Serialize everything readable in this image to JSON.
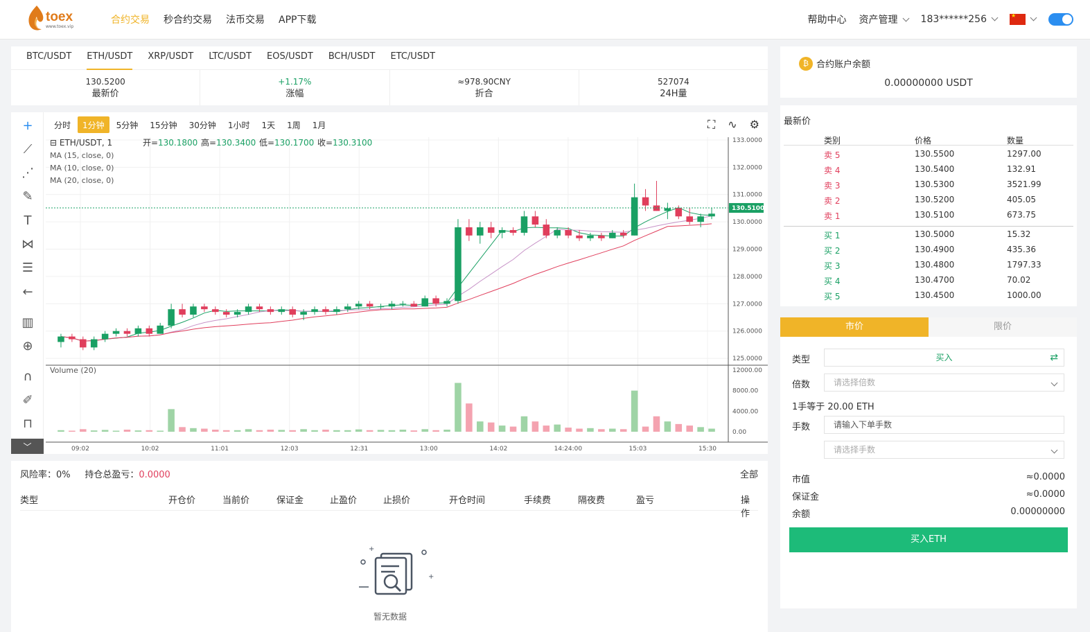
{
  "brand": {
    "name": "toex",
    "site": "www.toex.vip"
  },
  "nav": {
    "links": [
      "合约交易",
      "秒合约交易",
      "法币交易",
      "APP下载"
    ],
    "active": 0,
    "help": "帮助中心",
    "assets": "资产管理",
    "user": "183******256"
  },
  "pairs": [
    "BTC/USDT",
    "ETH/USDT",
    "XRP/USDT",
    "LTC/USDT",
    "EOS/USDT",
    "BCH/USDT",
    "ETC/USDT"
  ],
  "active_pair": 1,
  "stats": [
    {
      "value": "130.5200",
      "label": "最新价"
    },
    {
      "value": "+1.17%",
      "label": "涨幅"
    },
    {
      "value": "≈978.90CNY",
      "label": "折合"
    },
    {
      "value": "527074",
      "label": "24H量"
    }
  ],
  "intervals": [
    "分时",
    "1分钟",
    "5分钟",
    "15分钟",
    "30分钟",
    "1小时",
    "1天",
    "1周",
    "1月"
  ],
  "active_interval": 1,
  "chart_legend": {
    "symbol": "ETH/USDT, 1",
    "open_label": "开=",
    "open": "130.1800",
    "high_label": "高=",
    "high": "130.3400",
    "low_label": "低=",
    "low": "130.1700",
    "close_label": "收=",
    "close": "130.3100",
    "ma": [
      "MA (15, close, 0)",
      "MA (10, close, 0)",
      "MA (20, close, 0)"
    ],
    "volume": "Volume (20)"
  },
  "chart_data": {
    "type": "candlestick",
    "x_ticks": [
      "09:02",
      "10:02",
      "11:01",
      "12:03",
      "12:31",
      "13:00",
      "14:02",
      "14:24:00",
      "15:03",
      "15:30"
    ],
    "y_ticks": [
      "133.0000",
      "132.0000",
      "131.0000",
      "130.0000",
      "129.0000",
      "128.0000",
      "127.0000",
      "126.0000",
      "125.0000"
    ],
    "ylim": [
      124.8,
      133.1
    ],
    "last_price": "130.5100",
    "volume_ticks": [
      "12000.00",
      "8000.00",
      "4000.00",
      "0.00"
    ],
    "volume_ylim": [
      0,
      12000
    ],
    "candles": [
      [
        125.6,
        125.9,
        125.4,
        125.8
      ],
      [
        125.8,
        125.9,
        125.6,
        125.7
      ],
      [
        125.7,
        125.8,
        125.3,
        125.4
      ],
      [
        125.4,
        125.8,
        125.3,
        125.7
      ],
      [
        125.7,
        126.0,
        125.6,
        125.9
      ],
      [
        125.9,
        126.1,
        125.8,
        126.0
      ],
      [
        126.0,
        126.1,
        125.8,
        125.9
      ],
      [
        125.9,
        126.2,
        125.8,
        126.1
      ],
      [
        126.1,
        126.2,
        125.8,
        125.9
      ],
      [
        125.9,
        126.3,
        125.9,
        126.2
      ],
      [
        126.2,
        127.0,
        126.1,
        126.8
      ],
      [
        126.8,
        127.0,
        126.5,
        126.6
      ],
      [
        126.6,
        127.0,
        126.5,
        126.9
      ],
      [
        126.9,
        127.0,
        126.7,
        126.8
      ],
      [
        126.8,
        126.9,
        126.6,
        126.7
      ],
      [
        126.7,
        126.8,
        126.5,
        126.6
      ],
      [
        126.6,
        126.8,
        126.5,
        126.7
      ],
      [
        126.7,
        127.0,
        126.6,
        126.9
      ],
      [
        126.9,
        127.0,
        126.7,
        126.8
      ],
      [
        126.8,
        126.9,
        126.6,
        126.7
      ],
      [
        126.7,
        126.9,
        126.6,
        126.8
      ],
      [
        126.8,
        126.9,
        126.5,
        126.6
      ],
      [
        126.6,
        126.8,
        126.4,
        126.7
      ],
      [
        126.7,
        126.9,
        126.6,
        126.8
      ],
      [
        126.8,
        126.9,
        126.6,
        126.7
      ],
      [
        126.7,
        126.9,
        126.6,
        126.8
      ],
      [
        126.8,
        127.0,
        126.7,
        126.9
      ],
      [
        126.9,
        127.1,
        126.8,
        127.0
      ],
      [
        127.0,
        127.1,
        126.8,
        126.9
      ],
      [
        126.9,
        127.0,
        126.8,
        126.9
      ],
      [
        126.9,
        127.1,
        126.8,
        127.0
      ],
      [
        127.0,
        127.1,
        126.9,
        127.0
      ],
      [
        127.0,
        127.1,
        126.9,
        126.9
      ],
      [
        126.9,
        127.3,
        126.9,
        127.2
      ],
      [
        127.2,
        127.3,
        126.9,
        127.0
      ],
      [
        127.0,
        127.2,
        126.9,
        127.1
      ],
      [
        127.1,
        130.1,
        127.0,
        129.8
      ],
      [
        129.8,
        130.1,
        129.3,
        129.5
      ],
      [
        129.5,
        130.0,
        129.2,
        129.8
      ],
      [
        129.8,
        130.0,
        129.4,
        129.6
      ],
      [
        129.6,
        129.8,
        129.4,
        129.7
      ],
      [
        129.7,
        129.8,
        129.5,
        129.6
      ],
      [
        129.6,
        130.4,
        129.5,
        130.2
      ],
      [
        130.2,
        130.4,
        129.8,
        129.9
      ],
      [
        129.9,
        130.1,
        129.4,
        129.5
      ],
      [
        129.5,
        129.8,
        129.4,
        129.7
      ],
      [
        129.7,
        129.8,
        129.4,
        129.5
      ],
      [
        129.5,
        129.7,
        129.3,
        129.4
      ],
      [
        129.4,
        129.6,
        129.3,
        129.5
      ],
      [
        129.5,
        129.6,
        129.3,
        129.4
      ],
      [
        129.4,
        129.7,
        129.4,
        129.6
      ],
      [
        129.6,
        129.7,
        129.4,
        129.5
      ],
      [
        129.5,
        131.4,
        129.5,
        130.9
      ],
      [
        130.9,
        131.2,
        130.4,
        130.6
      ],
      [
        130.6,
        131.5,
        130.4,
        130.4
      ],
      [
        130.4,
        130.7,
        130.1,
        130.5
      ],
      [
        130.5,
        130.6,
        130.1,
        130.2
      ],
      [
        130.2,
        130.5,
        129.9,
        130.0
      ],
      [
        130.0,
        130.3,
        129.8,
        130.2
      ],
      [
        130.2,
        130.5,
        130.1,
        130.3
      ]
    ],
    "volumes": [
      300,
      200,
      500,
      250,
      350,
      200,
      400,
      250,
      300,
      200,
      4400,
      900,
      700,
      600,
      400,
      300,
      300,
      500,
      300,
      400,
      350,
      300,
      500,
      300,
      400,
      300,
      300,
      450,
      300,
      350,
      300,
      400,
      250,
      500,
      300,
      400,
      9500,
      5500,
      2000,
      1800,
      1200,
      1000,
      3000,
      2000,
      1200,
      1400,
      800,
      600,
      700,
      500,
      600,
      500,
      8000,
      1000,
      3000,
      2000,
      1500,
      1200,
      900,
      600
    ],
    "bull_color": "#1aa064",
    "bear_color": "#e03e5c",
    "ma_colors": [
      "#1aa064",
      "#c792c7",
      "#e03e5c"
    ]
  },
  "account": {
    "title": "合约账户余额",
    "balance": "0.00000000 USDT"
  },
  "orderbook": {
    "title": "最新价",
    "headers": [
      "类别",
      "价格",
      "数量"
    ],
    "asks": [
      {
        "label": "卖 5",
        "price": "130.5500",
        "qty": "1297.00"
      },
      {
        "label": "卖 4",
        "price": "130.5400",
        "qty": "132.91"
      },
      {
        "label": "卖 3",
        "price": "130.5300",
        "qty": "3521.99"
      },
      {
        "label": "卖 2",
        "price": "130.5200",
        "qty": "405.05"
      },
      {
        "label": "卖 1",
        "price": "130.5100",
        "qty": "673.75"
      }
    ],
    "bids": [
      {
        "label": "买 1",
        "price": "130.5000",
        "qty": "15.32"
      },
      {
        "label": "买 2",
        "price": "130.4900",
        "qty": "435.36"
      },
      {
        "label": "买 3",
        "price": "130.4800",
        "qty": "1797.33"
      },
      {
        "label": "买 4",
        "price": "130.4700",
        "qty": "70.02"
      },
      {
        "label": "买 5",
        "price": "130.4500",
        "qty": "1000.00"
      }
    ]
  },
  "trade": {
    "tabs": [
      "市价",
      "限价"
    ],
    "type_label": "类型",
    "type_value": "买入",
    "multiplier_label": "倍数",
    "multiplier_placeholder": "请选择倍数",
    "lot_note": "1手等于 20.00 ETH",
    "lots_label": "手数",
    "lots_placeholder": "请输入下单手数",
    "lots_select_placeholder": "请选择手数",
    "market_value_label": "市值",
    "market_value": "≈0.0000",
    "margin_label": "保证金",
    "margin": "≈0.0000",
    "balance_label": "余额",
    "balance": "0.00000000",
    "buy_button": "买入ETH"
  },
  "positions": {
    "risk_label": "风险率：",
    "risk": "0%",
    "pnl_label": "持仓总盈亏：",
    "pnl": "0.0000",
    "all": "全部",
    "columns": [
      "类型",
      "开仓价",
      "当前价",
      "保证金",
      "止盈价",
      "止损价",
      "开仓时间",
      "手续费",
      "隔夜费",
      "盈亏",
      "操作"
    ],
    "empty": "暂无数据"
  }
}
